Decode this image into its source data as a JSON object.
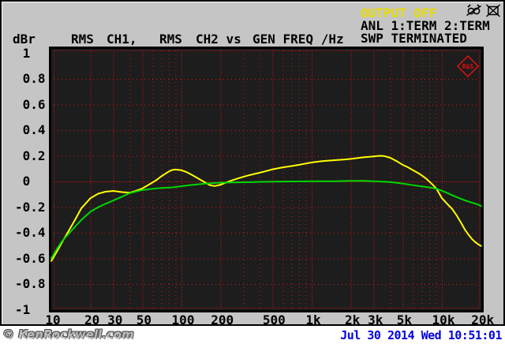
{
  "header": {
    "unit_label": "dBr",
    "trace_segments": [
      {
        "text": "RMS",
        "x": 88
      },
      {
        "text": "CH1,",
        "x": 133
      },
      {
        "text": "RMS",
        "x": 200
      },
      {
        "text": "CH2 vs",
        "x": 246
      },
      {
        "text": "GEN FREQ /Hz",
        "x": 318
      }
    ],
    "status": {
      "output": "OUTPUT OFF",
      "line1": "ANL 1:TERM 2:TERM",
      "line2": "SWP TERMINATED"
    },
    "icons": [
      "monitor-speaker-off-icon",
      "display-off-icon"
    ]
  },
  "chart_data": {
    "type": "line",
    "title": "RMS CH1, RMS CH2 vs GEN FREQ /Hz",
    "xlabel": "GEN FREQ /Hz",
    "ylabel": "dBr",
    "x_scale": "log",
    "xlim": [
      10,
      20000
    ],
    "ylim": [
      -1,
      1
    ],
    "grid_on": true,
    "logo_text": "R&S",
    "x_ticks": [
      {
        "f": 10,
        "label": "10"
      },
      {
        "f": 20,
        "label": "20"
      },
      {
        "f": 30,
        "label": "30"
      },
      {
        "f": 50,
        "label": "50"
      },
      {
        "f": 100,
        "label": "100"
      },
      {
        "f": 200,
        "label": "200"
      },
      {
        "f": 500,
        "label": "500"
      },
      {
        "f": 1000,
        "label": "1k"
      },
      {
        "f": 2000,
        "label": "2k"
      },
      {
        "f": 3000,
        "label": "3k"
      },
      {
        "f": 5000,
        "label": "5k"
      },
      {
        "f": 10000,
        "label": "10k"
      },
      {
        "f": 20000,
        "label": "20k"
      }
    ],
    "y_ticks": [
      {
        "v": 1,
        "label": " 1"
      },
      {
        "v": 0.8,
        "label": " 0.8"
      },
      {
        "v": 0.6,
        "label": " 0.6"
      },
      {
        "v": 0.4,
        "label": " 0.4"
      },
      {
        "v": 0.2,
        "label": " 0.2"
      },
      {
        "v": 0,
        "label": " 0"
      },
      {
        "v": -0.2,
        "label": "-0.2"
      },
      {
        "v": -0.4,
        "label": "-0.4"
      },
      {
        "v": -0.6,
        "label": "-0.6"
      },
      {
        "v": -0.8,
        "label": "-0.8"
      },
      {
        "v": -1,
        "label": "-1"
      }
    ],
    "grid": {
      "h_lines": [
        0.8,
        0.6,
        0.4,
        0.2,
        -0.2,
        -0.4,
        -0.6,
        -0.8
      ],
      "zero_line": 0,
      "v_major": [
        20,
        30,
        50,
        100,
        200,
        500,
        1000,
        2000,
        3000,
        5000,
        10000
      ],
      "v_minor": [
        40,
        60,
        70,
        80,
        90,
        300,
        400,
        600,
        700,
        800,
        900,
        4000,
        6000,
        7000,
        8000,
        9000
      ]
    },
    "series": [
      {
        "name": "RMS CH1",
        "color": "#ffff00",
        "points": [
          [
            10,
            -0.62
          ],
          [
            11,
            -0.55
          ],
          [
            12,
            -0.48
          ],
          [
            13,
            -0.42
          ],
          [
            15,
            -0.31
          ],
          [
            17,
            -0.21
          ],
          [
            20,
            -0.13
          ],
          [
            23,
            -0.095
          ],
          [
            26,
            -0.08
          ],
          [
            30,
            -0.074
          ],
          [
            35,
            -0.083
          ],
          [
            40,
            -0.088
          ],
          [
            45,
            -0.072
          ],
          [
            50,
            -0.055
          ],
          [
            55,
            -0.03
          ],
          [
            60,
            -0.008
          ],
          [
            65,
            0.015
          ],
          [
            70,
            0.04
          ],
          [
            75,
            0.06
          ],
          [
            80,
            0.078
          ],
          [
            85,
            0.09
          ],
          [
            90,
            0.093
          ],
          [
            100,
            0.088
          ],
          [
            110,
            0.072
          ],
          [
            120,
            0.052
          ],
          [
            135,
            0.022
          ],
          [
            150,
            -0.005
          ],
          [
            165,
            -0.028
          ],
          [
            180,
            -0.036
          ],
          [
            200,
            -0.025
          ],
          [
            220,
            -0.008
          ],
          [
            250,
            0.012
          ],
          [
            280,
            0.028
          ],
          [
            320,
            0.045
          ],
          [
            360,
            0.058
          ],
          [
            400,
            0.068
          ],
          [
            450,
            0.082
          ],
          [
            500,
            0.095
          ],
          [
            600,
            0.11
          ],
          [
            700,
            0.12
          ],
          [
            800,
            0.13
          ],
          [
            1000,
            0.148
          ],
          [
            1200,
            0.158
          ],
          [
            1500,
            0.166
          ],
          [
            1800,
            0.172
          ],
          [
            2000,
            0.176
          ],
          [
            2500,
            0.188
          ],
          [
            3000,
            0.196
          ],
          [
            3300,
            0.2
          ],
          [
            3600,
            0.198
          ],
          [
            4000,
            0.185
          ],
          [
            4500,
            0.158
          ],
          [
            5000,
            0.13
          ],
          [
            5500,
            0.11
          ],
          [
            6000,
            0.088
          ],
          [
            6500,
            0.068
          ],
          [
            7000,
            0.048
          ],
          [
            7500,
            0.025
          ],
          [
            8000,
            0.0
          ],
          [
            8500,
            -0.025
          ],
          [
            9000,
            -0.052
          ],
          [
            9500,
            -0.09
          ],
          [
            10000,
            -0.13
          ],
          [
            11000,
            -0.175
          ],
          [
            12000,
            -0.215
          ],
          [
            13000,
            -0.265
          ],
          [
            14000,
            -0.32
          ],
          [
            15000,
            -0.375
          ],
          [
            16000,
            -0.415
          ],
          [
            17000,
            -0.448
          ],
          [
            18000,
            -0.472
          ],
          [
            19000,
            -0.49
          ],
          [
            20000,
            -0.503
          ]
        ]
      },
      {
        "name": "RMS CH2",
        "color": "#00d800",
        "points": [
          [
            10,
            -0.6
          ],
          [
            11,
            -0.53
          ],
          [
            12,
            -0.47
          ],
          [
            13,
            -0.43
          ],
          [
            15,
            -0.36
          ],
          [
            17,
            -0.3
          ],
          [
            20,
            -0.235
          ],
          [
            23,
            -0.2
          ],
          [
            26,
            -0.175
          ],
          [
            30,
            -0.148
          ],
          [
            35,
            -0.118
          ],
          [
            40,
            -0.092
          ],
          [
            45,
            -0.078
          ],
          [
            50,
            -0.067
          ],
          [
            60,
            -0.057
          ],
          [
            70,
            -0.051
          ],
          [
            85,
            -0.046
          ],
          [
            100,
            -0.037
          ],
          [
            120,
            -0.027
          ],
          [
            150,
            -0.017
          ],
          [
            200,
            -0.009
          ],
          [
            300,
            -0.006
          ],
          [
            400,
            -0.003
          ],
          [
            500,
            -0.001
          ],
          [
            700,
            0.0
          ],
          [
            1000,
            0.001
          ],
          [
            1500,
            0.002
          ],
          [
            2000,
            0.005
          ],
          [
            2500,
            0.004
          ],
          [
            3000,
            0.001
          ],
          [
            3500,
            -0.001
          ],
          [
            4000,
            -0.005
          ],
          [
            5000,
            -0.016
          ],
          [
            6000,
            -0.029
          ],
          [
            7000,
            -0.039
          ],
          [
            8000,
            -0.046
          ],
          [
            9000,
            -0.056
          ],
          [
            10000,
            -0.072
          ],
          [
            11000,
            -0.09
          ],
          [
            12000,
            -0.107
          ],
          [
            13000,
            -0.122
          ],
          [
            15000,
            -0.147
          ],
          [
            17000,
            -0.165
          ],
          [
            18000,
            -0.172
          ],
          [
            19000,
            -0.181
          ],
          [
            20000,
            -0.192
          ]
        ]
      }
    ]
  },
  "footer": {
    "watermark": "© KenRockwell.com",
    "datetime": "Jul 30 2014 Wed 10:51:01"
  },
  "colors": {
    "screen_bg": "#c5c5c5",
    "plot_bg": "#1d1d1d",
    "grid": "#e01010",
    "trace1": "#ffff00",
    "trace2": "#00d800",
    "status_yellow": "#e8dc00",
    "date_blue": "#0000e0"
  }
}
